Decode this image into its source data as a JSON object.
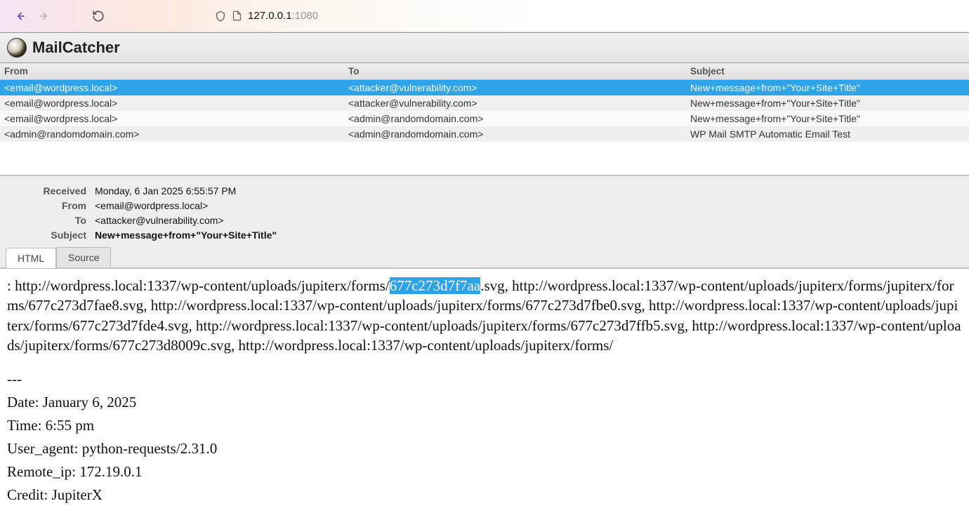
{
  "browser": {
    "url_host": "127.0.0.1",
    "url_port": ":1080"
  },
  "app": {
    "title": "MailCatcher"
  },
  "columns": {
    "from": "From",
    "to": "To",
    "subject": "Subject"
  },
  "messages": [
    {
      "from": "<email@wordpress.local>",
      "to": "<attacker@vulnerability.com>",
      "subject": "New+message+from+\"Your+Site+Title\"",
      "selected": true
    },
    {
      "from": "<email@wordpress.local>",
      "to": "<attacker@vulnerability.com>",
      "subject": "New+message+from+\"Your+Site+Title\"",
      "selected": false
    },
    {
      "from": "<email@wordpress.local>",
      "to": "<admin@randomdomain.com>",
      "subject": "New+message+from+\"Your+Site+Title\"",
      "selected": false
    },
    {
      "from": "<admin@randomdomain.com>",
      "to": "<admin@randomdomain.com>",
      "subject": "WP Mail SMTP Automatic Email Test",
      "selected": false
    }
  ],
  "detail": {
    "labels": {
      "received": "Received",
      "from": "From",
      "to": "To",
      "subject": "Subject"
    },
    "received": "Monday, 6 Jan 2025 6:55:57 PM",
    "from": "<email@wordpress.local>",
    "to": "<attacker@vulnerability.com>",
    "subject": "New+message+from+\"Your+Site+Title\""
  },
  "tabs": {
    "html": "HTML",
    "source": "Source"
  },
  "body": {
    "url_prefix": ": http://wordpress.local:1337/wp-content/uploads/jupiterx/forms/",
    "highlighted": "677c273d7f7aa",
    "url_rest": ".svg, http://wordpress.local:1337/wp-content/uploads/jupiterx/forms/jupiterx/forms/677c273d7fae8.svg, http://wordpress.local:1337/wp-content/uploads/jupiterx/forms/677c273d7fbe0.svg, http://wordpress.local:1337/wp-content/uploads/jupiterx/forms/677c273d7fde4.svg, http://wordpress.local:1337/wp-content/uploads/jupiterx/forms/677c273d7ffb5.svg, http://wordpress.local:1337/wp-content/uploads/jupiterx/forms/677c273d8009c.svg, http://wordpress.local:1337/wp-content/uploads/jupiterx/forms/",
    "separator": "---",
    "meta_date": "Date: January 6, 2025",
    "meta_time": "Time: 6:55 pm",
    "meta_ua": "User_agent: python-requests/2.31.0",
    "meta_ip": "Remote_ip: 172.19.0.1",
    "meta_credit": "Credit: JupiterX"
  }
}
